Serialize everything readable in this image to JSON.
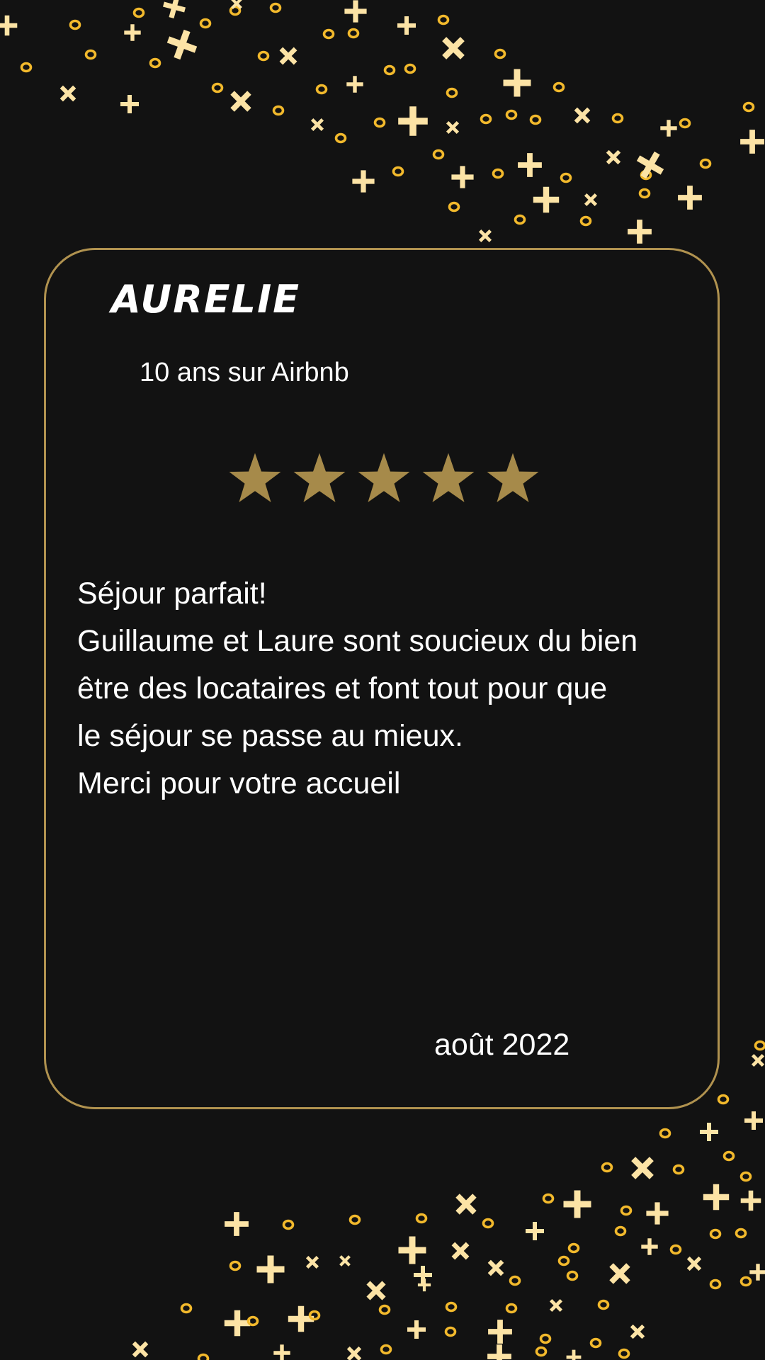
{
  "review": {
    "reviewer_name": "AURELIE",
    "member_since": "10 ans sur Airbnb",
    "rating": 5,
    "rating_max": 5,
    "text_lines": [
      "Séjour parfait!",
      "Guillaume et Laure sont soucieux du bien",
      "être des locataires et font tout pour que",
      "le séjour se passe au mieux.",
      "Merci pour votre accueil"
    ],
    "date": "août 2022"
  },
  "colors": {
    "background": "#121212",
    "accent_gold": "#b0924f",
    "star": "#a68a4a",
    "confetti_cross": "#fce3a5",
    "confetti_ring": "#f2b92c",
    "text": "#ffffff"
  },
  "icons": {
    "star": "star-icon",
    "decoration": "confetti-decoration"
  }
}
